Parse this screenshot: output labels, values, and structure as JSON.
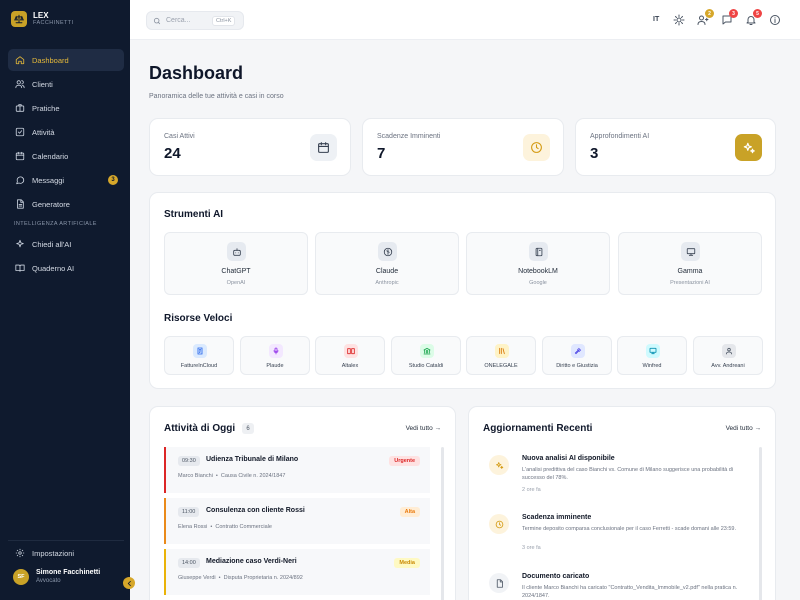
{
  "brand": {
    "title": "LEX",
    "subtitle": "FACCHINETTI"
  },
  "sidebar": {
    "items": [
      {
        "label": "Dashboard",
        "icon": "home-icon"
      },
      {
        "label": "Clienti",
        "icon": "users-icon"
      },
      {
        "label": "Pratiche",
        "icon": "briefcase-icon"
      },
      {
        "label": "Attività",
        "icon": "check-square-icon"
      },
      {
        "label": "Calendario",
        "icon": "calendar-icon"
      },
      {
        "label": "Messaggi",
        "icon": "message-icon",
        "badge": "3"
      },
      {
        "label": "Generatore",
        "icon": "document-icon"
      }
    ],
    "section_label": "INTELLIGENZA ARTIFICIALE",
    "ai_items": [
      {
        "label": "Chiedi all'AI",
        "icon": "sparkles-icon"
      },
      {
        "label": "Quaderno AI",
        "icon": "book-icon"
      }
    ],
    "settings_label": "Impostazioni",
    "user": {
      "initials": "SF",
      "name": "Simone Facchinetti",
      "role": "Avvocato"
    }
  },
  "topbar": {
    "search_placeholder": "Cerca...",
    "search_shortcut": "Ctrl+K",
    "language": "IT",
    "badges": {
      "users": "2",
      "messages": "3",
      "notifications": "5"
    }
  },
  "dashboard": {
    "title": "Dashboard",
    "subtitle": "Panoramica delle tue attività e casi in corso",
    "stats": [
      {
        "label": "Casi Attivi",
        "value": "24"
      },
      {
        "label": "Scadenze Imminenti",
        "value": "7"
      },
      {
        "label": "Approfondimenti AI",
        "value": "3"
      }
    ],
    "ai_tools_title": "Strumenti AI",
    "ai_tools": [
      {
        "name": "ChatGPT",
        "provider": "OpenAI"
      },
      {
        "name": "Claude",
        "provider": "Anthropic"
      },
      {
        "name": "NotebookLM",
        "provider": "Google"
      },
      {
        "name": "Gamma",
        "provider": "Presentazioni AI"
      }
    ],
    "resources_title": "Risorse Veloci",
    "resources": [
      {
        "name": "FattureInCloud"
      },
      {
        "name": "Plaude"
      },
      {
        "name": "Altalex"
      },
      {
        "name": "Studio Cataldi"
      },
      {
        "name": "ONELEGALE"
      },
      {
        "name": "Diritto e Giustizia"
      },
      {
        "name": "Winfred"
      },
      {
        "name": "Avv. Andreani"
      }
    ]
  },
  "activities": {
    "title": "Attività di Oggi",
    "count": "6",
    "see_all": "Vedi tutto",
    "items": [
      {
        "time": "09:30",
        "title": "Udienza Tribunale di Milano",
        "person": "Marco Bianchi",
        "case": "Causa Civile n. 2024/1847",
        "priority": "Urgente"
      },
      {
        "time": "11:00",
        "title": "Consulenza con cliente Rossi",
        "person": "Elena Rossi",
        "case": "Contratto Commerciale",
        "priority": "Alta"
      },
      {
        "time": "14:00",
        "title": "Mediazione caso Verdi-Neri",
        "person": "Giuseppe Verdi",
        "case": "Disputa Proprietaria n. 2024/892",
        "priority": "Media"
      }
    ]
  },
  "updates": {
    "title": "Aggiornamenti Recenti",
    "see_all": "Vedi tutto",
    "items": [
      {
        "title": "Nuova analisi AI disponibile",
        "desc": "L'analisi predittiva del caso Bianchi vs. Comune di Milano suggerisce una probabilità di successo del 78%.",
        "time": "2 ore fa"
      },
      {
        "title": "Scadenza imminente",
        "desc": "Termine deposito comparsa conclusionale per il caso Ferretti - scade domani alle 23:59.",
        "time": "3 ore fa"
      },
      {
        "title": "Documento caricato",
        "desc": "Il cliente Marco Bianchi ha caricato \"Contratto_Vendita_Immobile_v2.pdf\" nella pratica n. 2024/1847.",
        "time": ""
      }
    ]
  },
  "colors": {
    "sidebar_bg": "#0f1a2e",
    "accent_gold": "#c9a227",
    "urgent": "#dc2626",
    "high": "#ea8a1a",
    "medium": "#eab308"
  }
}
